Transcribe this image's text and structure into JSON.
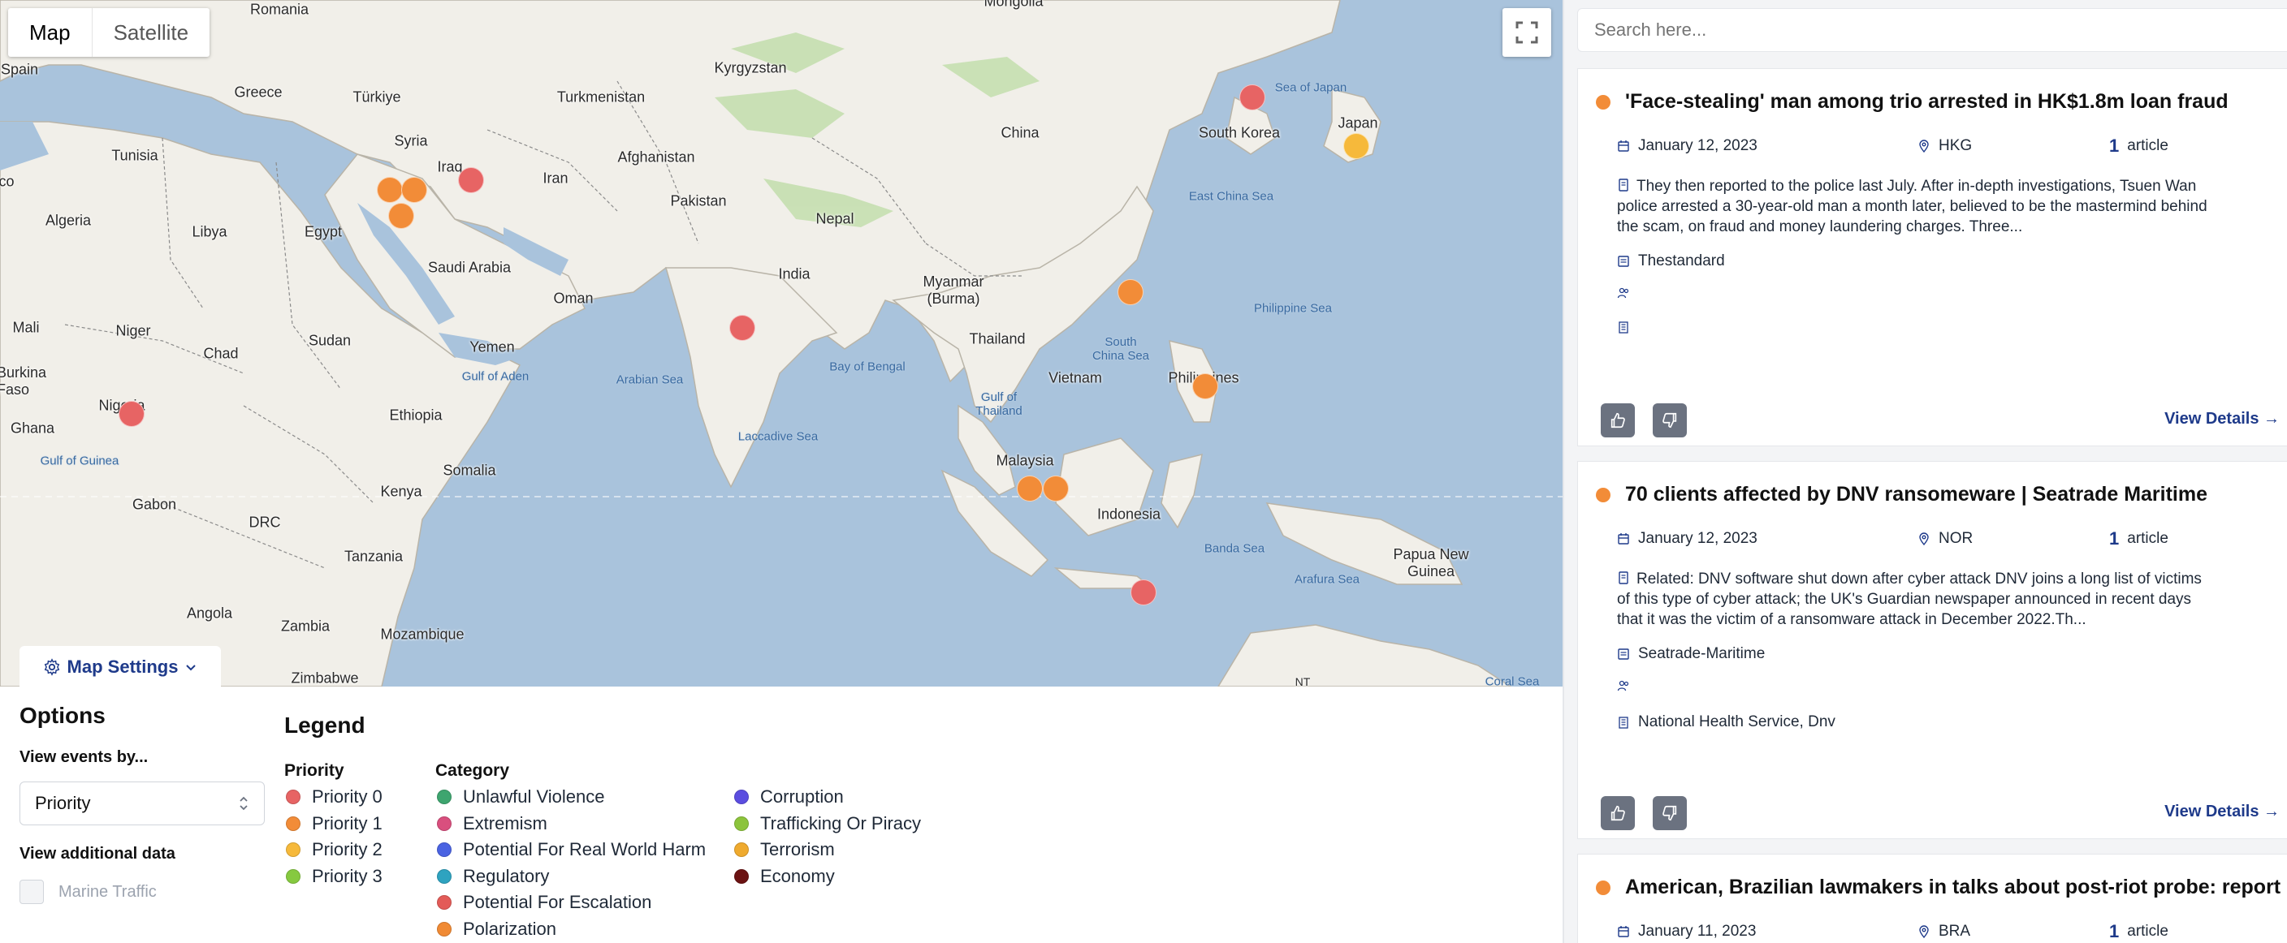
{
  "map": {
    "type_buttons": [
      "Map",
      "Satellite"
    ],
    "settings_label": "Map Settings",
    "countries": [
      {
        "name": "Romania"
      },
      {
        "name": "Mongolia"
      },
      {
        "name": "Spain"
      },
      {
        "name": "Greece"
      },
      {
        "name": "Türkiye"
      },
      {
        "name": "Turkmenistan"
      },
      {
        "name": "Kyrgyzstan"
      },
      {
        "name": "Tunisia"
      },
      {
        "name": "Syria"
      },
      {
        "name": "Iraq"
      },
      {
        "name": "Iran"
      },
      {
        "name": "Afghanistan"
      },
      {
        "name": "China"
      },
      {
        "name": "South Korea"
      },
      {
        "name": "Japan"
      },
      {
        "name": "Algeria"
      },
      {
        "name": "Libya"
      },
      {
        "name": "Egypt"
      },
      {
        "name": "Pakistan"
      },
      {
        "name": "Nepal"
      },
      {
        "name": "Saudi Arabia"
      },
      {
        "name": "India"
      },
      {
        "name": "Oman"
      },
      {
        "name": "Myanmar (Burma)"
      },
      {
        "name": "Mali"
      },
      {
        "name": "Niger"
      },
      {
        "name": "Chad"
      },
      {
        "name": "Sudan"
      },
      {
        "name": "Yemen"
      },
      {
        "name": "Thailand"
      },
      {
        "name": "Burkina Faso"
      },
      {
        "name": "Vietnam"
      },
      {
        "name": "Philippines"
      },
      {
        "name": "Ghana"
      },
      {
        "name": "Nigeria"
      },
      {
        "name": "Ethiopia"
      },
      {
        "name": "Somalia"
      },
      {
        "name": "Malaysia"
      },
      {
        "name": "Gabon"
      },
      {
        "name": "Kenya"
      },
      {
        "name": "DRC"
      },
      {
        "name": "Indonesia"
      },
      {
        "name": "Papua New Guinea"
      },
      {
        "name": "Tanzania"
      },
      {
        "name": "Angola"
      },
      {
        "name": "Zambia"
      },
      {
        "name": "Mozambique"
      },
      {
        "name": "Zimbabwe"
      },
      {
        "name": "NT"
      },
      {
        "name": "co"
      }
    ],
    "seas": [
      "Sea of Japan",
      "East China Sea",
      "Philippine Sea",
      "South China Sea",
      "Bay of Bengal",
      "Arabian Sea",
      "Gulf of Aden",
      "Laccadive Sea",
      "Gulf of Thailand",
      "Gulf of Guinea",
      "Banda Sea",
      "Arafura Sea",
      "Coral Sea"
    ],
    "markers": [
      {
        "priority": 0
      },
      {
        "priority": 1
      },
      {
        "priority": 1
      },
      {
        "priority": 1
      },
      {
        "priority": 0
      },
      {
        "priority": 2
      },
      {
        "priority": 0
      },
      {
        "priority": 1
      },
      {
        "priority": 1
      },
      {
        "priority": 0
      },
      {
        "priority": 1
      },
      {
        "priority": 1
      },
      {
        "priority": 0
      }
    ]
  },
  "options": {
    "title": "Options",
    "view_by_label": "View events by...",
    "view_by_value": "Priority",
    "additional_label": "View additional data",
    "marine_label": "Marine Traffic"
  },
  "legend": {
    "title": "Legend",
    "priority_heading": "Priority",
    "priorities": [
      {
        "label": "Priority 0",
        "color": "#e76464"
      },
      {
        "label": "Priority 1",
        "color": "#f28c38"
      },
      {
        "label": "Priority 2",
        "color": "#f6b93b"
      },
      {
        "label": "Priority 3",
        "color": "#86c940"
      }
    ],
    "category_heading": "Category",
    "categories": [
      {
        "label": "Unlawful Violence",
        "color": "#3ea56f"
      },
      {
        "label": "Extremism",
        "color": "#d94f7e"
      },
      {
        "label": "Potential For Real World Harm",
        "color": "#4a63e2"
      },
      {
        "label": "Regulatory",
        "color": "#2ea3c0"
      },
      {
        "label": "Potential For Escalation",
        "color": "#e35b58"
      },
      {
        "label": "Polarization",
        "color": "#f08a34"
      },
      {
        "label": "Corruption",
        "color": "#5b4de0"
      },
      {
        "label": "Trafficking Or Piracy",
        "color": "#8cc43c"
      },
      {
        "label": "Terrorism",
        "color": "#efaa2e"
      },
      {
        "label": "Economy",
        "color": "#6b1212"
      }
    ]
  },
  "panel": {
    "search_placeholder": "Search here...",
    "cards": [
      {
        "title": "'Face-stealing' man among trio arrested in HK$1.8m loan fraud",
        "date": "January 12, 2023",
        "location": "HKG",
        "count": "1",
        "count_label": "article",
        "description": "They then reported to the police last July. After in-depth investigations, Tsuen Wan police arrested a 30-year-old man a month later, believed to be the mastermind behind the scam, on fraud and money laundering charges. Three...",
        "source": "Thestandard",
        "people": "",
        "organizations": "",
        "view_label": "View Details →"
      },
      {
        "title": "70 clients affected by DNV ransomeware | Seatrade Maritime",
        "date": "January 12, 2023",
        "location": "NOR",
        "count": "1",
        "count_label": "article",
        "description": "Related: DNV software shut down after cyber attack DNV joins a long list of victims of this type of cyber attack; the UK's Guardian newspaper announced in recent days that it was the victim of a ransomware attack in December 2022.Th...",
        "source": "Seatrade-Maritime",
        "people": "",
        "organizations": "National Health Service, Dnv",
        "view_label": "View Details →"
      },
      {
        "title": "American, Brazilian lawmakers in talks about post-riot probe: report",
        "date": "January 11, 2023",
        "location": "BRA",
        "count": "1",
        "count_label": "article"
      }
    ]
  }
}
